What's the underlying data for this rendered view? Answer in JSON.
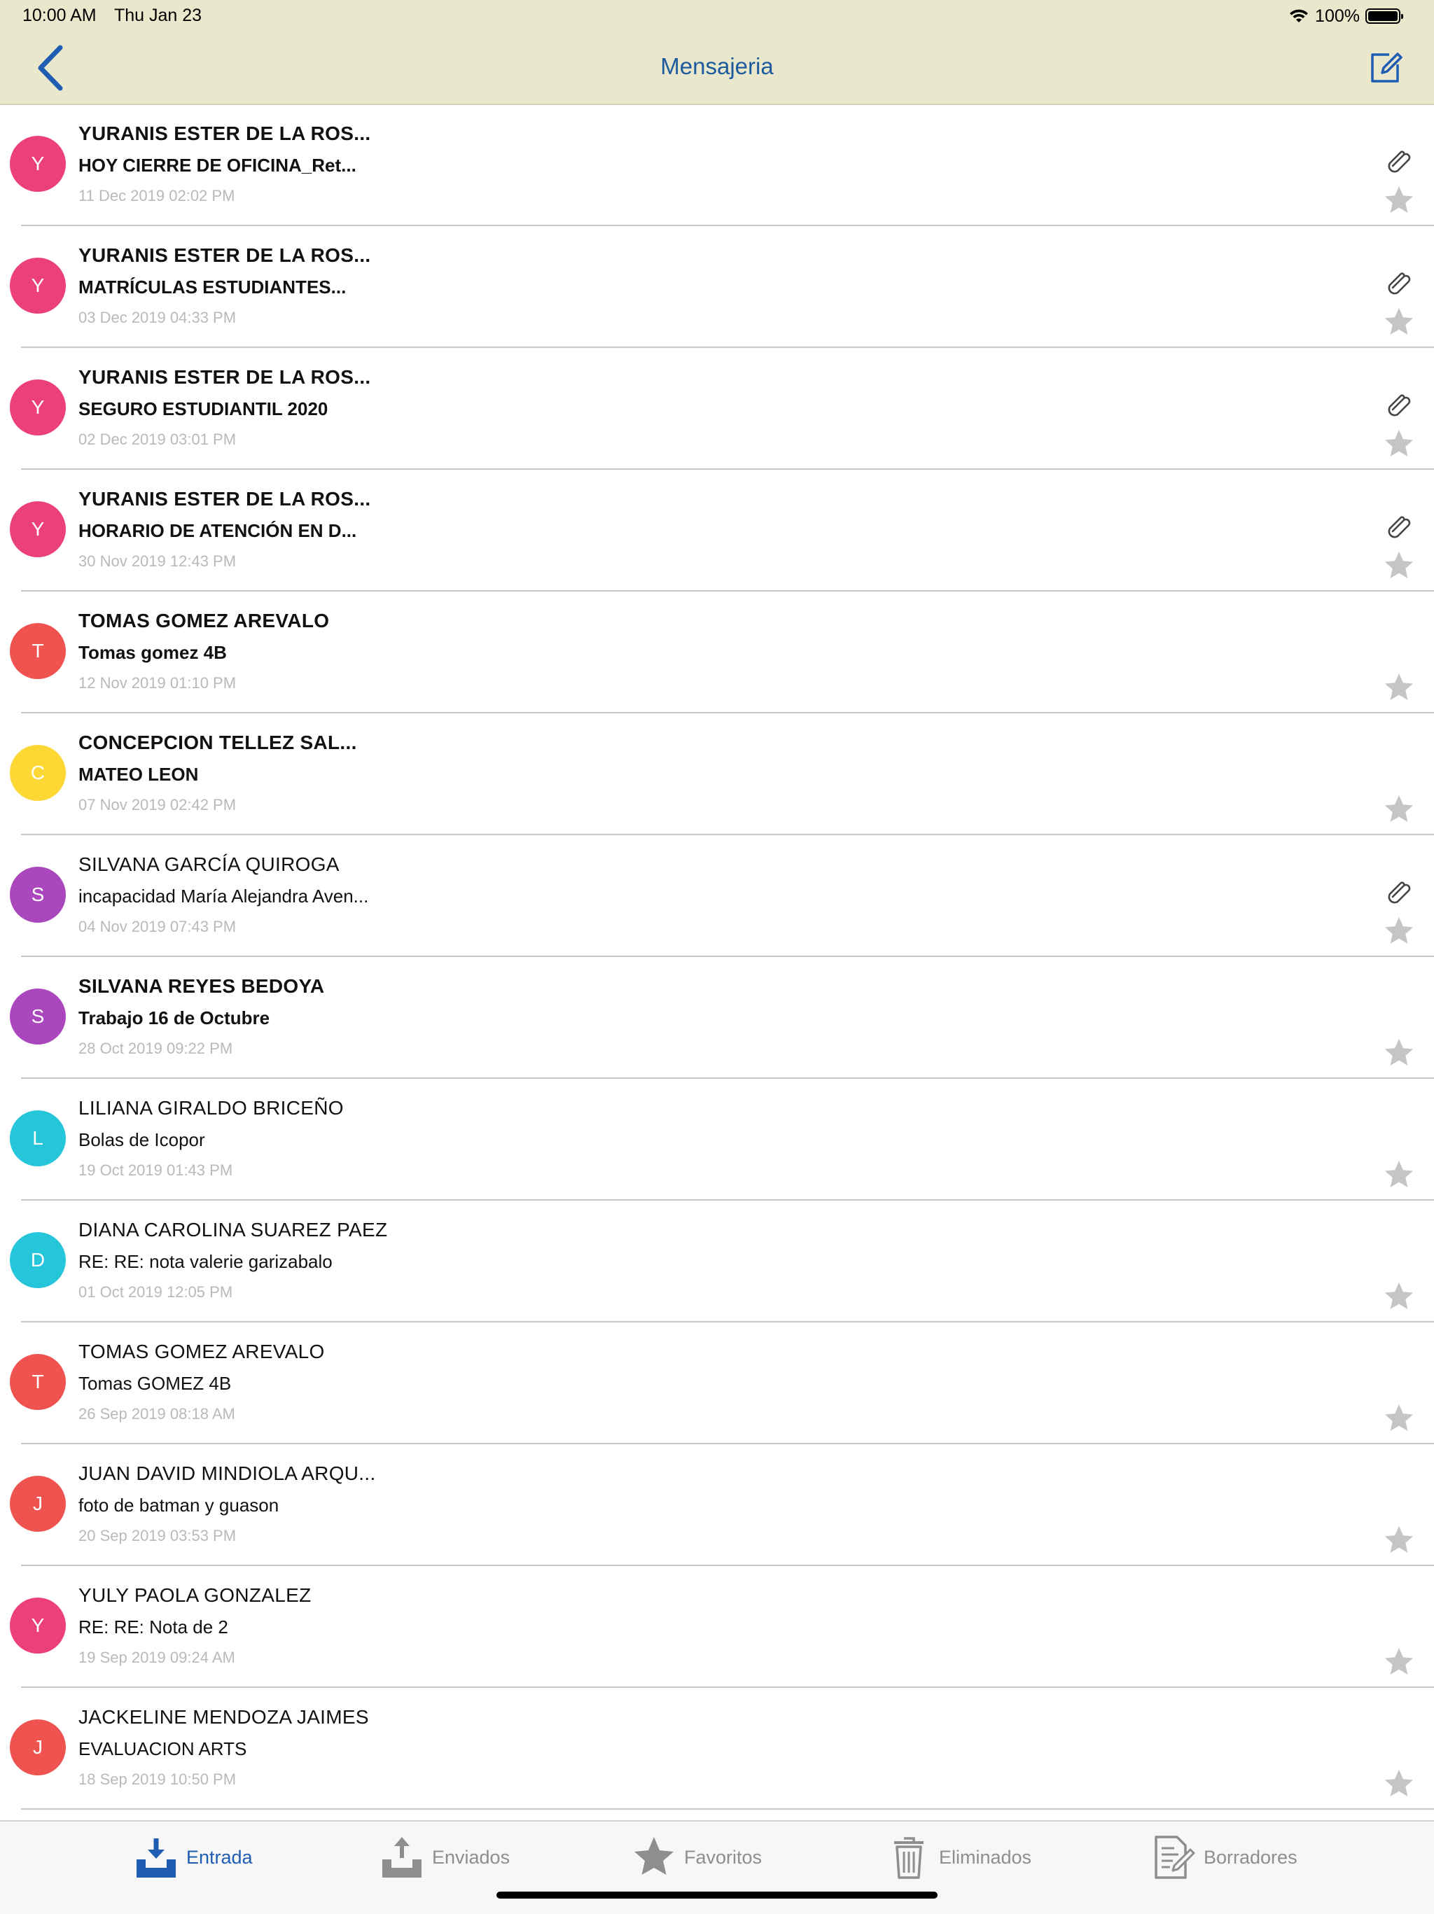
{
  "status_bar": {
    "time": "10:00 AM",
    "date": "Thu Jan 23",
    "battery": "100%"
  },
  "nav": {
    "title": "Mensajeria",
    "back_icon": "chevron-left-icon",
    "compose_icon": "compose-icon"
  },
  "colors": {
    "accent": "#1f5db3",
    "nav_background": "#e9e7cc",
    "star": "#c5c5c5",
    "date_text": "#b9b9b9"
  },
  "messages": [
    {
      "initial": "Y",
      "avatar_color": "#ec407a",
      "sender": "YURANIS ESTER DE LA ROS...",
      "subject": "HOY CIERRE DE OFICINA_Ret...",
      "date": "11 Dec 2019 02:02 PM",
      "unread": true,
      "attachment": true
    },
    {
      "initial": "Y",
      "avatar_color": "#ec407a",
      "sender": "YURANIS ESTER DE LA ROS...",
      "subject": "MATRÍCULAS ESTUDIANTES...",
      "date": "03 Dec 2019 04:33 PM",
      "unread": true,
      "attachment": true
    },
    {
      "initial": "Y",
      "avatar_color": "#ec407a",
      "sender": "YURANIS ESTER DE LA ROS...",
      "subject": "SEGURO ESTUDIANTIL 2020",
      "date": "02 Dec 2019 03:01 PM",
      "unread": true,
      "attachment": true
    },
    {
      "initial": "Y",
      "avatar_color": "#ec407a",
      "sender": "YURANIS ESTER DE LA ROS...",
      "subject": "HORARIO DE ATENCIÓN EN D...",
      "date": "30 Nov 2019 12:43 PM",
      "unread": true,
      "attachment": true
    },
    {
      "initial": "T",
      "avatar_color": "#ef5350",
      "sender": "TOMAS GOMEZ AREVALO",
      "subject": "Tomas gomez 4B",
      "date": "12 Nov 2019 01:10 PM",
      "unread": true,
      "attachment": false
    },
    {
      "initial": "C",
      "avatar_color": "#fdd835",
      "sender": "CONCEPCION TELLEZ SAL...",
      "subject": "MATEO LEON",
      "date": "07 Nov 2019 02:42 PM",
      "unread": true,
      "attachment": false
    },
    {
      "initial": "S",
      "avatar_color": "#ab47bc",
      "sender": "SILVANA GARCÍA QUIROGA",
      "subject": "incapacidad María Alejandra Aven...",
      "date": "04 Nov 2019 07:43 PM",
      "unread": false,
      "attachment": true
    },
    {
      "initial": "S",
      "avatar_color": "#ab47bc",
      "sender": "SILVANA REYES BEDOYA",
      "subject": "Trabajo 16 de Octubre",
      "date": "28 Oct 2019 09:22 PM",
      "unread": true,
      "attachment": false
    },
    {
      "initial": "L",
      "avatar_color": "#26c6da",
      "sender": "LILIANA GIRALDO BRICEÑO",
      "subject": "Bolas de Icopor",
      "date": "19 Oct 2019 01:43 PM",
      "unread": false,
      "attachment": false
    },
    {
      "initial": "D",
      "avatar_color": "#26c6da",
      "sender": "DIANA CAROLINA SUAREZ PAEZ",
      "subject": "RE: RE: nota  valerie  garizabalo",
      "date": "01 Oct 2019 12:05 PM",
      "unread": false,
      "attachment": false
    },
    {
      "initial": "T",
      "avatar_color": "#ef5350",
      "sender": "TOMAS GOMEZ AREVALO",
      "subject": "Tomas GOMEZ 4B",
      "date": "26 Sep 2019 08:18 AM",
      "unread": false,
      "attachment": false
    },
    {
      "initial": "J",
      "avatar_color": "#ef5350",
      "sender": "JUAN  DAVID MINDIOLA ARQU...",
      "subject": "foto de batman y guason",
      "date": "20 Sep 2019 03:53 PM",
      "unread": false,
      "attachment": false
    },
    {
      "initial": "Y",
      "avatar_color": "#ec407a",
      "sender": "YULY PAOLA GONZALEZ",
      "subject": "RE: RE: Nota de 2",
      "date": "19 Sep 2019 09:24 AM",
      "unread": false,
      "attachment": false
    },
    {
      "initial": "J",
      "avatar_color": "#ef5350",
      "sender": "JACKELINE MENDOZA JAIMES",
      "subject": "EVALUACION  ARTS",
      "date": "18 Sep 2019 10:50 PM",
      "unread": false,
      "attachment": false
    }
  ],
  "tabs": [
    {
      "label": "Entrada",
      "icon": "inbox-download-icon",
      "active": true
    },
    {
      "label": "Enviados",
      "icon": "outbox-upload-icon",
      "active": false
    },
    {
      "label": "Favoritos",
      "icon": "star-icon",
      "active": false
    },
    {
      "label": "Eliminados",
      "icon": "trash-icon",
      "active": false
    },
    {
      "label": "Borradores",
      "icon": "draft-document-icon",
      "active": false
    }
  ]
}
